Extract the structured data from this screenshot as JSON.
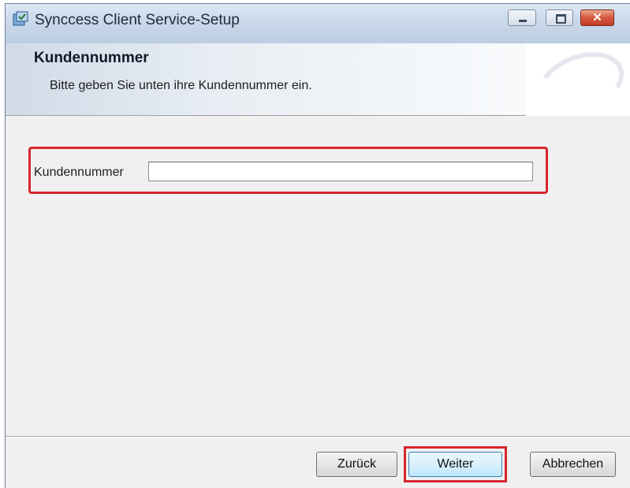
{
  "window": {
    "title": "Synccess Client Service-Setup",
    "icons": {
      "app": "installer-icon",
      "minimize": "minimize-icon",
      "maximize": "maximize-icon",
      "close": "close-icon"
    },
    "close_glyph": "✕"
  },
  "banner": {
    "title": "Kundennummer",
    "subtitle": "Bitte geben Sie unten ihre Kundennummer ein."
  },
  "form": {
    "customer_number_label": "Kundennummer",
    "customer_number_value": "",
    "customer_number_placeholder": ""
  },
  "buttons": {
    "back": "Zurück",
    "next": "Weiter",
    "cancel": "Abbrechen"
  },
  "colors": {
    "highlight": "#d6262e",
    "title_bar": "#cbd9ea",
    "default_button_border": "#3c7fb1"
  }
}
